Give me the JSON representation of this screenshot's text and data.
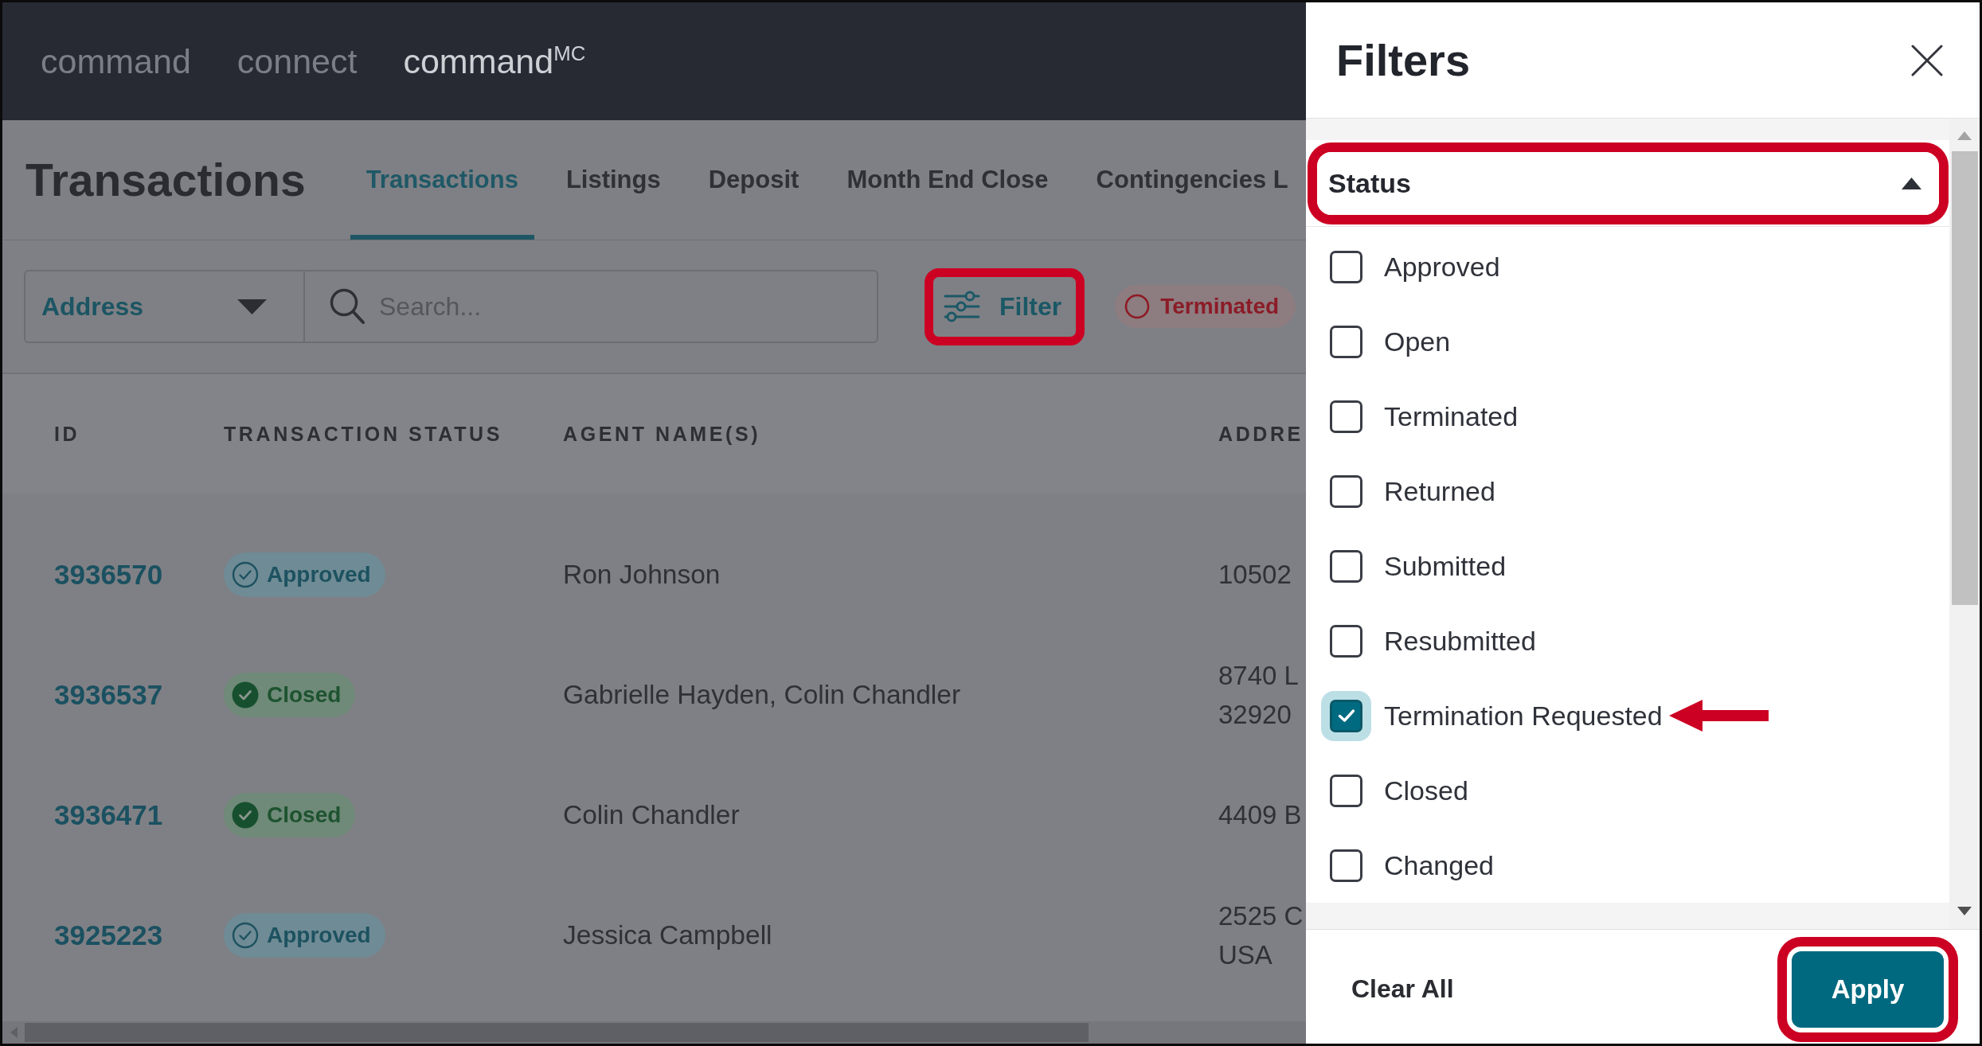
{
  "top_nav": {
    "items": [
      {
        "label": "command",
        "selected": false
      },
      {
        "label": "connect",
        "selected": false
      },
      {
        "label": "command$^{MC}$",
        "selected": true
      }
    ]
  },
  "page_header": {
    "title": "Transactions",
    "tabs": [
      {
        "label": "Transactions",
        "selected": true
      },
      {
        "label": "Listings",
        "selected": false
      },
      {
        "label": "Deposit",
        "selected": false
      },
      {
        "label": "Month End Close",
        "selected": false
      },
      {
        "label": "Contingencies L",
        "selected": false
      }
    ]
  },
  "toolbar": {
    "search_by": {
      "value": "Address"
    },
    "search": {
      "placeholder": "Search..."
    },
    "filter_button": {
      "label": "Filter",
      "highlighted": true
    },
    "filter_chips": [
      {
        "label": "Terminated"
      }
    ]
  },
  "table": {
    "columns": [
      "ID",
      "TRANSACTION STATUS",
      "AGENT NAME(S)",
      "ADDRE"
    ],
    "rows": [
      {
        "id": "3936570",
        "status": {
          "kind": "approved",
          "label": "Approved"
        },
        "agents": "Ron Johnson",
        "address": "10502"
      },
      {
        "id": "3936537",
        "status": {
          "kind": "closed",
          "label": "Closed"
        },
        "agents": "Gabrielle Hayden, Colin Chandler",
        "address": "8740 L\n32920"
      },
      {
        "id": "3936471",
        "status": {
          "kind": "closed",
          "label": "Closed"
        },
        "agents": "Colin Chandler",
        "address": "4409 B"
      },
      {
        "id": "3925223",
        "status": {
          "kind": "approved",
          "label": "Approved"
        },
        "agents": "Jessica Campbell",
        "address": "2525 C\nUSA"
      }
    ]
  },
  "filters_panel": {
    "title": "Filters",
    "sections": [
      {
        "title": "Status",
        "expanded": true,
        "highlighted": true,
        "options": [
          {
            "label": "Approved",
            "checked": false,
            "annotated": false
          },
          {
            "label": "Open",
            "checked": false,
            "annotated": false
          },
          {
            "label": "Terminated",
            "checked": false,
            "annotated": false
          },
          {
            "label": "Returned",
            "checked": false,
            "annotated": false
          },
          {
            "label": "Submitted",
            "checked": false,
            "annotated": false
          },
          {
            "label": "Resubmitted",
            "checked": false,
            "annotated": false
          },
          {
            "label": "Termination Requested",
            "checked": true,
            "annotated": true
          },
          {
            "label": "Closed",
            "checked": false,
            "annotated": false
          },
          {
            "label": "Changed",
            "checked": false,
            "annotated": false
          }
        ]
      }
    ],
    "clear_button": {
      "label": "Clear All"
    },
    "apply_button": {
      "label": "Apply",
      "highlighted": true
    }
  }
}
